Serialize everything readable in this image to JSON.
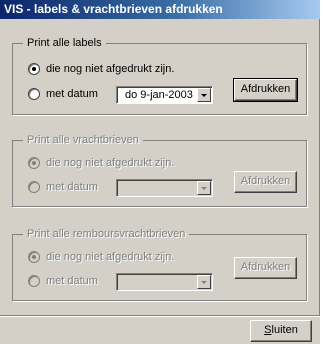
{
  "window": {
    "title": "VIS - labels & vrachtbrieven afdrukken"
  },
  "groups": [
    {
      "legend": "Print alle labels",
      "option_not_printed": "die nog niet afgedrukt zijn.",
      "option_with_date": "met datum",
      "date_value": "do 9-jan-2003",
      "print_button": "Afdrukken",
      "enabled": true
    },
    {
      "legend": "Print alle vrachtbrieven",
      "option_not_printed": "die nog niet afgedrukt zijn.",
      "option_with_date": "met datum",
      "date_value": "",
      "print_button": "Afdrukken",
      "enabled": false
    },
    {
      "legend": "Print alle remboursvrachtbrieven",
      "option_not_printed": "die nog niet afgedrukt zijn.",
      "option_with_date": "met datum",
      "date_value": "",
      "print_button": "Afdrukken",
      "enabled": false
    }
  ],
  "footer": {
    "close_label_underlined": "S",
    "close_label_rest": "luiten"
  },
  "colors": {
    "titlebar_start": "#0a246a",
    "titlebar_end": "#a6caf0",
    "face": "#d4d0c8"
  }
}
